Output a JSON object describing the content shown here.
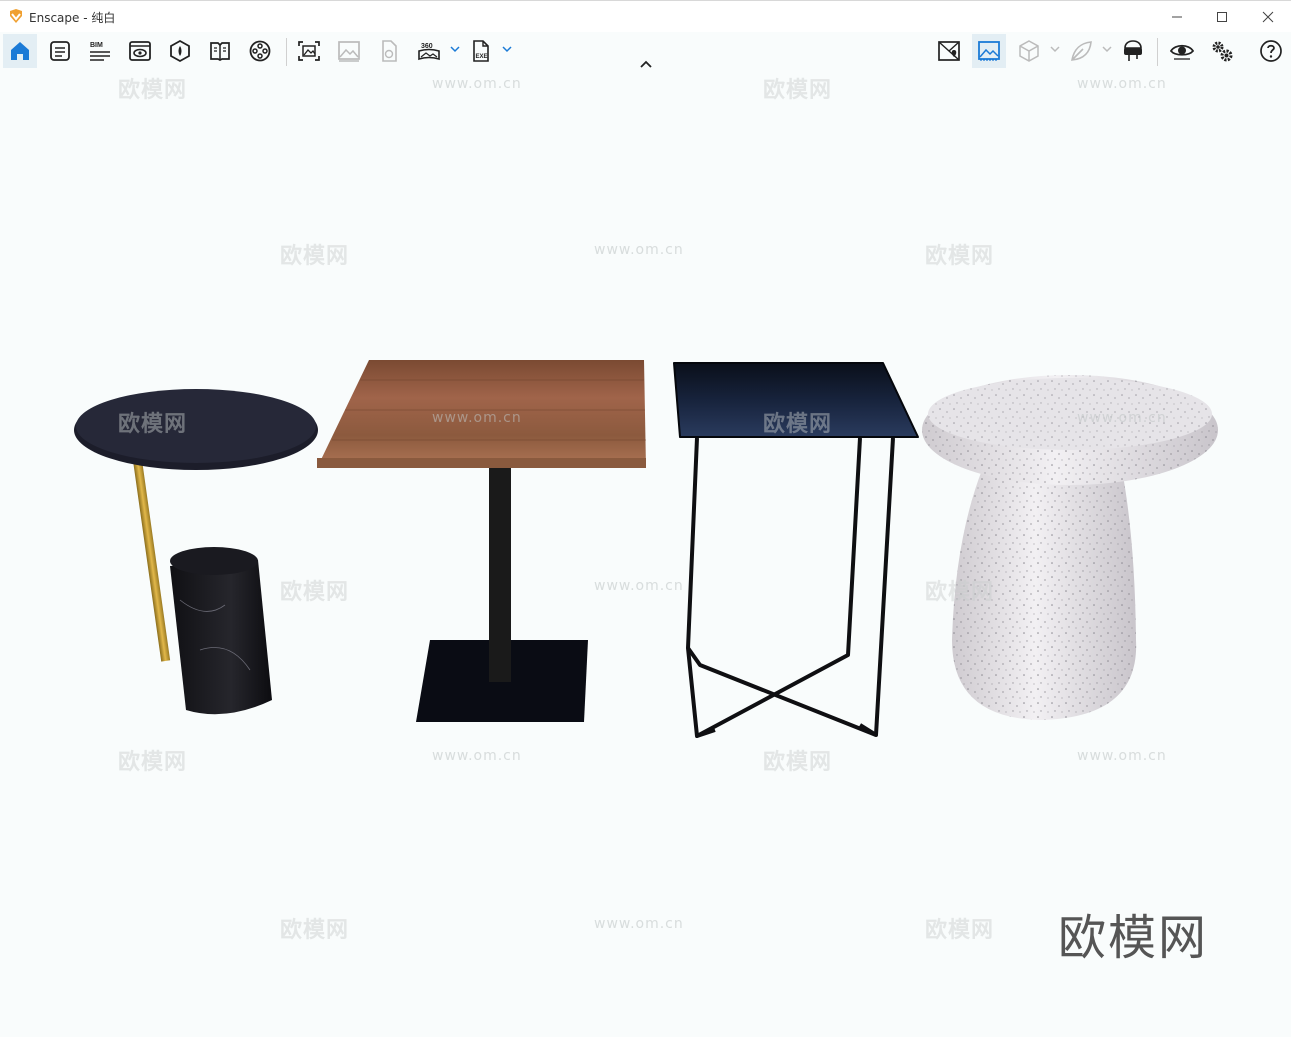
{
  "window": {
    "title": "Enscape - 纯白",
    "accent_color": "#1b7ad6",
    "brand_color": "#f0a030",
    "controls": [
      "minimize-icon",
      "maximize-icon",
      "close-icon"
    ]
  },
  "toolbar": {
    "left_tools": [
      {
        "name": "home-icon",
        "active": true
      },
      {
        "name": "panel-list-icon",
        "active": false
      },
      {
        "name": "bim-icon",
        "active": false,
        "label": "BIM"
      },
      {
        "name": "view-window-icon",
        "active": false
      },
      {
        "name": "material-icon",
        "active": false
      },
      {
        "name": "book-icon",
        "active": false
      },
      {
        "name": "video-reel-icon",
        "active": false
      }
    ],
    "capture_tools": [
      {
        "name": "screenshot-icon",
        "active": false
      },
      {
        "name": "gallery-icon",
        "active": false
      },
      {
        "name": "upload-icon",
        "active": false
      },
      {
        "name": "panorama-360-icon",
        "active": false,
        "label": "360"
      },
      {
        "name": "exe-export-icon",
        "active": false,
        "label": "EXE"
      }
    ],
    "right_tools": [
      {
        "name": "map-pin-icon",
        "active": false
      },
      {
        "name": "image-view-icon",
        "active": true
      },
      {
        "name": "cube-icon",
        "active": false
      },
      {
        "name": "leaf-icon",
        "active": false
      },
      {
        "name": "vr-headset-icon",
        "active": false
      },
      {
        "name": "eye-icon",
        "active": false
      },
      {
        "name": "settings-gears-icon",
        "active": false
      },
      {
        "name": "help-icon",
        "active": false
      }
    ]
  },
  "viewport": {
    "background": "#f9fcfc",
    "watermark_text": "欧模网",
    "watermark_url": "www.om.cn",
    "brand_logo": "欧模网"
  }
}
